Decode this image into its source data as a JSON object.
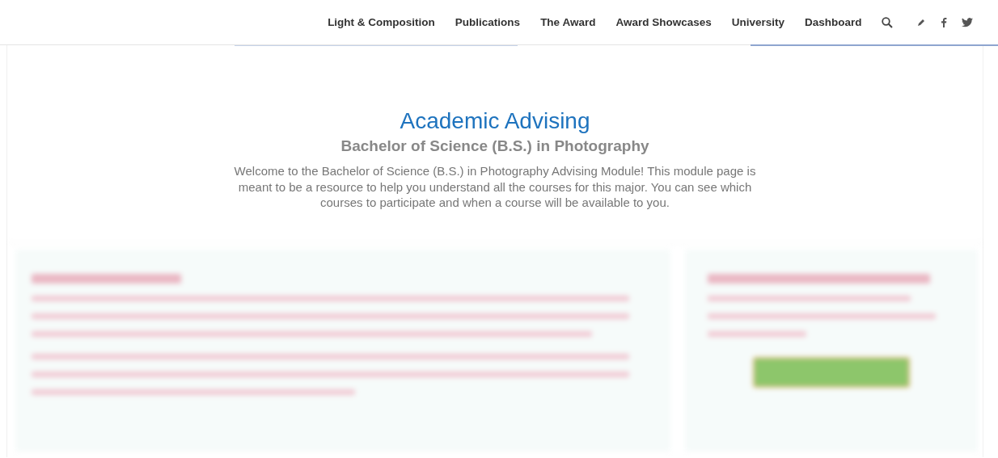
{
  "nav": {
    "items": [
      {
        "label": "Light & Composition"
      },
      {
        "label": "Publications"
      },
      {
        "label": "The Award"
      },
      {
        "label": "Award Showcases"
      },
      {
        "label": "University"
      },
      {
        "label": "Dashboard"
      }
    ]
  },
  "hero": {
    "title": "Academic Advising",
    "subtitle": "Bachelor of Science (B.S.) in Photography",
    "intro": "Welcome to the Bachelor of Science (B.S.) in Photography Advising Module! This module page is meant to be a resource to help you understand all the courses for this major. You can see which courses to participate and when a course will be available to you."
  }
}
